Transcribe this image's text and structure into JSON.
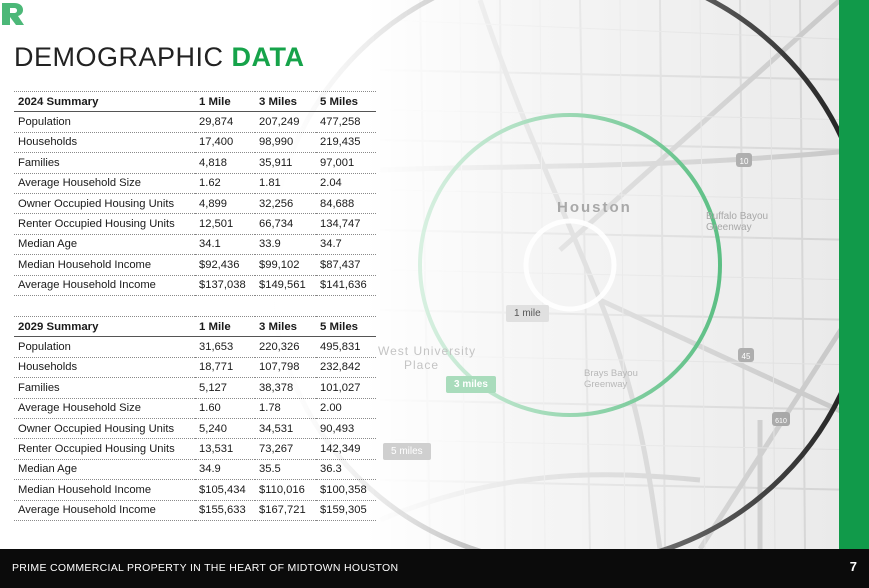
{
  "title": {
    "main": "DEMOGRAPHIC",
    "accent": "DATA"
  },
  "table_2024": {
    "headers": [
      "2024 Summary",
      "1 Mile",
      "3 Miles",
      "5 Miles"
    ],
    "rows": [
      [
        "Population",
        "29,874",
        "207,249",
        "477,258"
      ],
      [
        "Households",
        "17,400",
        "98,990",
        "219,435"
      ],
      [
        "Families",
        "4,818",
        "35,911",
        "97,001"
      ],
      [
        "Average Household Size",
        "1.62",
        "1.81",
        "2.04"
      ],
      [
        "Owner Occupied Housing Units",
        "4,899",
        "32,256",
        "84,688"
      ],
      [
        "Renter Occupied Housing Units",
        "12,501",
        "66,734",
        "134,747"
      ],
      [
        "Median Age",
        "34.1",
        "33.9",
        "34.7"
      ],
      [
        "Median Household Income",
        "$92,436",
        "$99,102",
        "$87,437"
      ],
      [
        "Average Household Income",
        "$137,038",
        "$149,561",
        "$141,636"
      ]
    ]
  },
  "table_2029": {
    "headers": [
      "2029 Summary",
      "1 Mile",
      "3 Miles",
      "5 Miles"
    ],
    "rows": [
      [
        "Population",
        "31,653",
        "220,326",
        "495,831"
      ],
      [
        "Households",
        "18,771",
        "107,798",
        "232,842"
      ],
      [
        "Families",
        "5,127",
        "38,378",
        "101,027"
      ],
      [
        "Average Household Size",
        "1.60",
        "1.78",
        "2.00"
      ],
      [
        "Owner Occupied Housing Units",
        "5,240",
        "34,531",
        "90,493"
      ],
      [
        "Renter Occupied Housing Units",
        "13,531",
        "73,267",
        "142,349"
      ],
      [
        "Median Age",
        "34.9",
        "35.5",
        "36.3"
      ],
      [
        "Median Household Income",
        "$105,434",
        "$110,016",
        "$100,358"
      ],
      [
        "Average Household Income",
        "$155,633",
        "$167,721",
        "$159,305"
      ]
    ]
  },
  "map": {
    "city": "Houston",
    "neighborhood": [
      "West University",
      "Place"
    ],
    "park_1": [
      "Buffalo Bayou",
      "Greenway"
    ],
    "park_2": [
      "Brays Bayou",
      "Greenway"
    ],
    "radius_labels": {
      "one": "1 mile",
      "three": "3 miles",
      "five": "5 miles"
    },
    "highway_shields": [
      "10",
      "45",
      "610"
    ],
    "marker_icon": "property-logo-pin-icon"
  },
  "footer": {
    "text": "PRIME COMMERCIAL PROPERTY IN THE HEART OF MIDTOWN HOUSTON",
    "page": "7"
  },
  "colors": {
    "accent": "#16a34a",
    "strip": "#119a4a",
    "ring_3": "#6cc48f",
    "ring_5": "#3a3a3a",
    "footer_bg": "#0b0b0b"
  }
}
